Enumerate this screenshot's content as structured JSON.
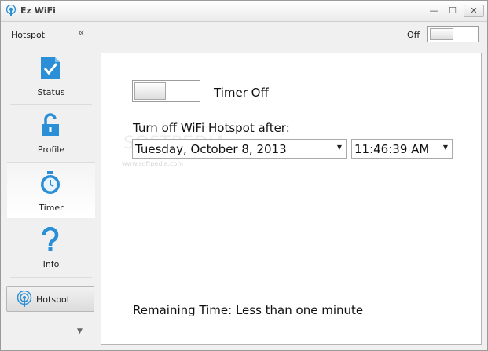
{
  "window": {
    "title": "Ez WiFi",
    "minimize_glyph": "—",
    "maximize_glyph": "☐",
    "close_glyph": "✕"
  },
  "header": {
    "section_label": "Hotspot",
    "collapse_glyph": "«",
    "hotspot_state_label": "Off"
  },
  "sidebar": {
    "items": [
      {
        "label": "Status",
        "icon": "checkbox-icon"
      },
      {
        "label": "Profile",
        "icon": "unlock-icon"
      },
      {
        "label": "Timer",
        "icon": "stopwatch-icon",
        "selected": true
      },
      {
        "label": "Info",
        "icon": "question-icon"
      }
    ],
    "hotspot_button_label": "Hotspot",
    "expand_glyph": "▼"
  },
  "timer": {
    "toggle_label": "Timer Off",
    "turn_off_label": "Turn off WiFi Hotspot after:",
    "date_value": "Tuesday, October 8, 2013",
    "time_value": "11:46:39 AM",
    "dropdown_glyph": "▼",
    "remaining_text": "Remaining Time: Less than one minute"
  },
  "watermark": {
    "text": "SOFTPEDIA",
    "subtext": "www.softpedia.com"
  },
  "colors": {
    "accent_blue": "#2a8fd6",
    "panel_bg": "#ffffff",
    "window_bg": "#f0f0f0"
  }
}
